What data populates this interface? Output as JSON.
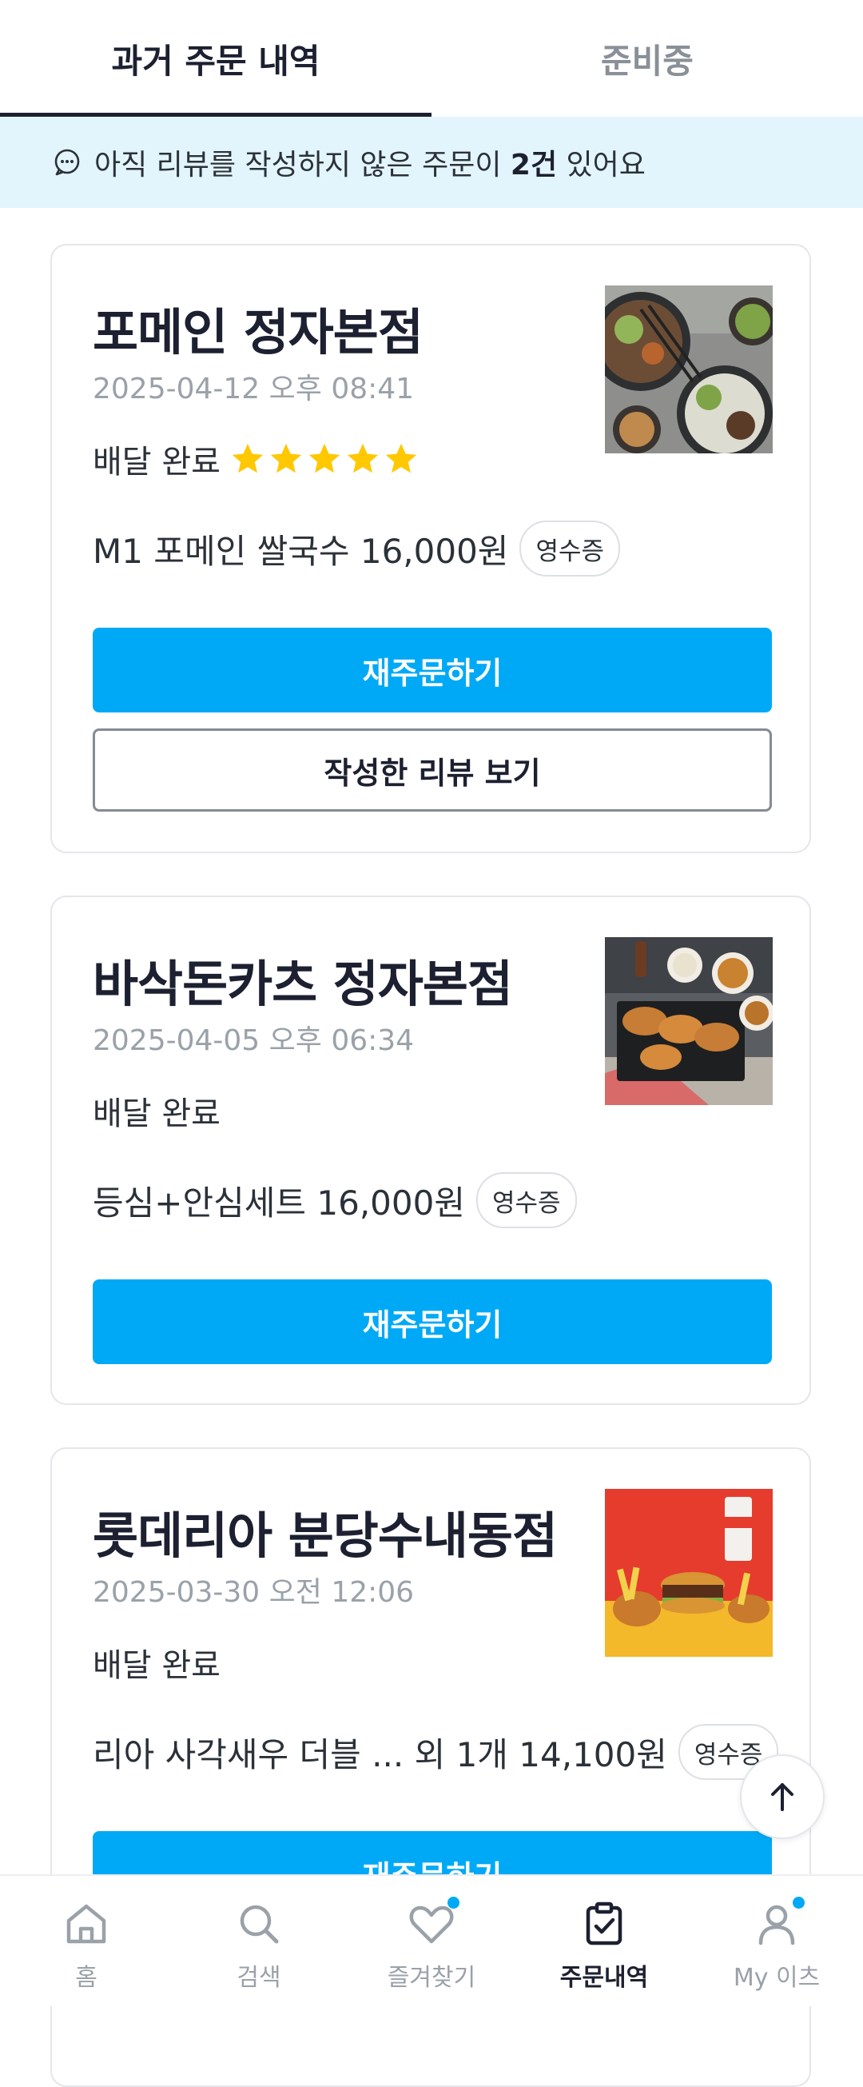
{
  "tabs": [
    {
      "label": "과거 주문 내역",
      "active": true
    },
    {
      "label": "준비중",
      "active": false
    }
  ],
  "banner": {
    "text_before": "아직 리뷰를 작성하지 않은 주문이 ",
    "count": "2건",
    "text_after": " 있어요",
    "icon": "chat-bubble-icon"
  },
  "orders": [
    {
      "store": "포메인 정자본점",
      "date": "2025-04-12 오후 08:41",
      "status": "배달 완료",
      "rating": 5,
      "item": "M1 포메인 쌀국수 16,000원",
      "receipt": "영수증",
      "reorder": "재주문하기",
      "review": "작성한 리뷰 보기",
      "image": "pho-dishes"
    },
    {
      "store": "바삭돈카츠 정자본점",
      "date": "2025-04-05 오후 06:34",
      "status": "배달 완료",
      "item": "등심+안심세트 16,000원",
      "receipt": "영수증",
      "reorder": "재주문하기",
      "image": "tonkatsu-set"
    },
    {
      "store": "롯데리아 분당수내동점",
      "date": "2025-03-30 오전 12:06",
      "status": "배달 완료",
      "item": "리아 사각새우 더블 ...  외 1개 14,100원",
      "receipt": "영수증",
      "reorder": "재주문하기",
      "image": "burger-set"
    }
  ],
  "bottom_nav": [
    {
      "label": "홈",
      "icon": "home-icon",
      "active": false
    },
    {
      "label": "검색",
      "icon": "search-icon",
      "active": false
    },
    {
      "label": "즐겨찾기",
      "icon": "heart-icon",
      "active": false,
      "badge": true
    },
    {
      "label": "주문내역",
      "icon": "clipboard-check-icon",
      "active": true
    },
    {
      "label": "My 이츠",
      "icon": "user-icon",
      "active": false,
      "badge": true
    }
  ],
  "colors": {
    "accent": "#00a9f6",
    "banner_bg": "#e3f5fc",
    "star": "#ffc800",
    "text_dark": "#1c2030",
    "text_muted": "#9aa1a9"
  }
}
